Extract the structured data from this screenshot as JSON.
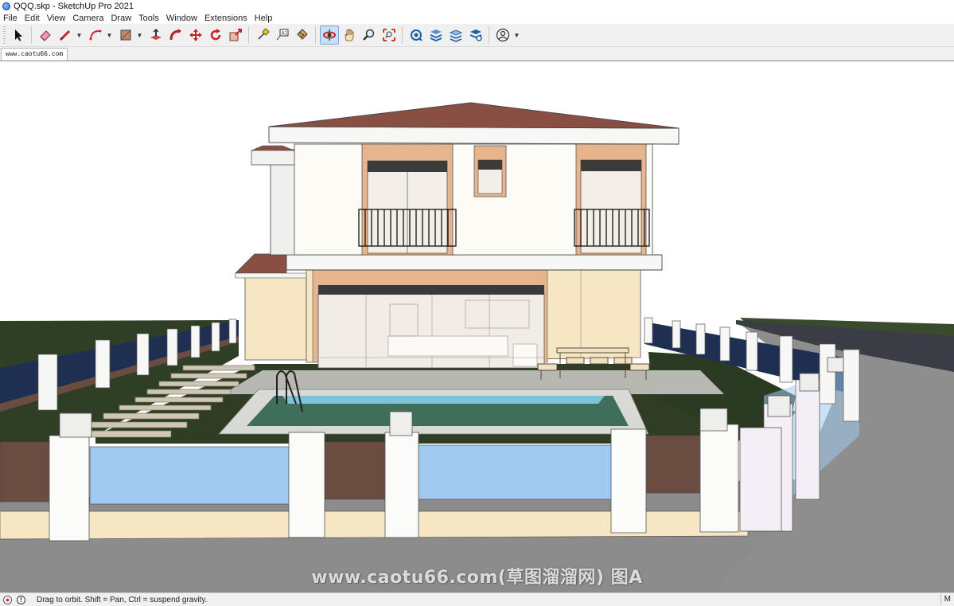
{
  "window": {
    "title": "QQQ.skp - SketchUp Pro 2021"
  },
  "menu": [
    "File",
    "Edit",
    "View",
    "Camera",
    "Draw",
    "Tools",
    "Window",
    "Extensions",
    "Help"
  ],
  "toolbar": {
    "tools": [
      {
        "name": "select-tool-icon"
      },
      {
        "name": "eraser-tool-icon"
      },
      {
        "name": "line-tool-icon",
        "dropdown": true
      },
      {
        "name": "arc-tool-icon",
        "dropdown": true
      },
      {
        "name": "rectangle-tool-icon",
        "dropdown": true
      },
      {
        "name": "push-pull-tool-icon"
      },
      {
        "name": "follow-me-tool-icon"
      },
      {
        "name": "move-tool-icon"
      },
      {
        "name": "rotate-tool-icon"
      },
      {
        "name": "scale-tool-icon"
      },
      {
        "name": "tape-measure-tool-icon"
      },
      {
        "name": "text-tool-icon"
      },
      {
        "name": "paint-bucket-tool-icon"
      },
      {
        "name": "orbit-tool-icon",
        "active": true
      },
      {
        "name": "pan-tool-icon"
      },
      {
        "name": "zoom-tool-icon"
      },
      {
        "name": "zoom-extents-tool-icon"
      },
      {
        "name": "warehouse-icon"
      },
      {
        "name": "extension-warehouse-icon"
      },
      {
        "name": "layout-icon"
      },
      {
        "name": "extension-manager-icon"
      },
      {
        "name": "account-icon",
        "dropdown": true
      }
    ]
  },
  "scene_tab": {
    "label": "www.caotu66.com"
  },
  "viewport": {
    "watermark": "www.caotu66.com(草图溜溜网) 图A",
    "colors": {
      "roof": "#8a4f43",
      "wall": "#fdfbf5",
      "accent_wall": "#e6b58e",
      "ground_floor_wall": "#f6e6c4",
      "lawn": "#2f3f25",
      "pool_water": "#3f6f5a",
      "fence_glass": "#9fc9ef",
      "fence_panel": "#6a4d40",
      "road": "#8c8c8c",
      "dark_fence_glass": "#1e2f52"
    }
  },
  "status": {
    "text": "Drag to orbit. Shift = Pan, Ctrl = suspend gravity.",
    "right_label": "M"
  }
}
